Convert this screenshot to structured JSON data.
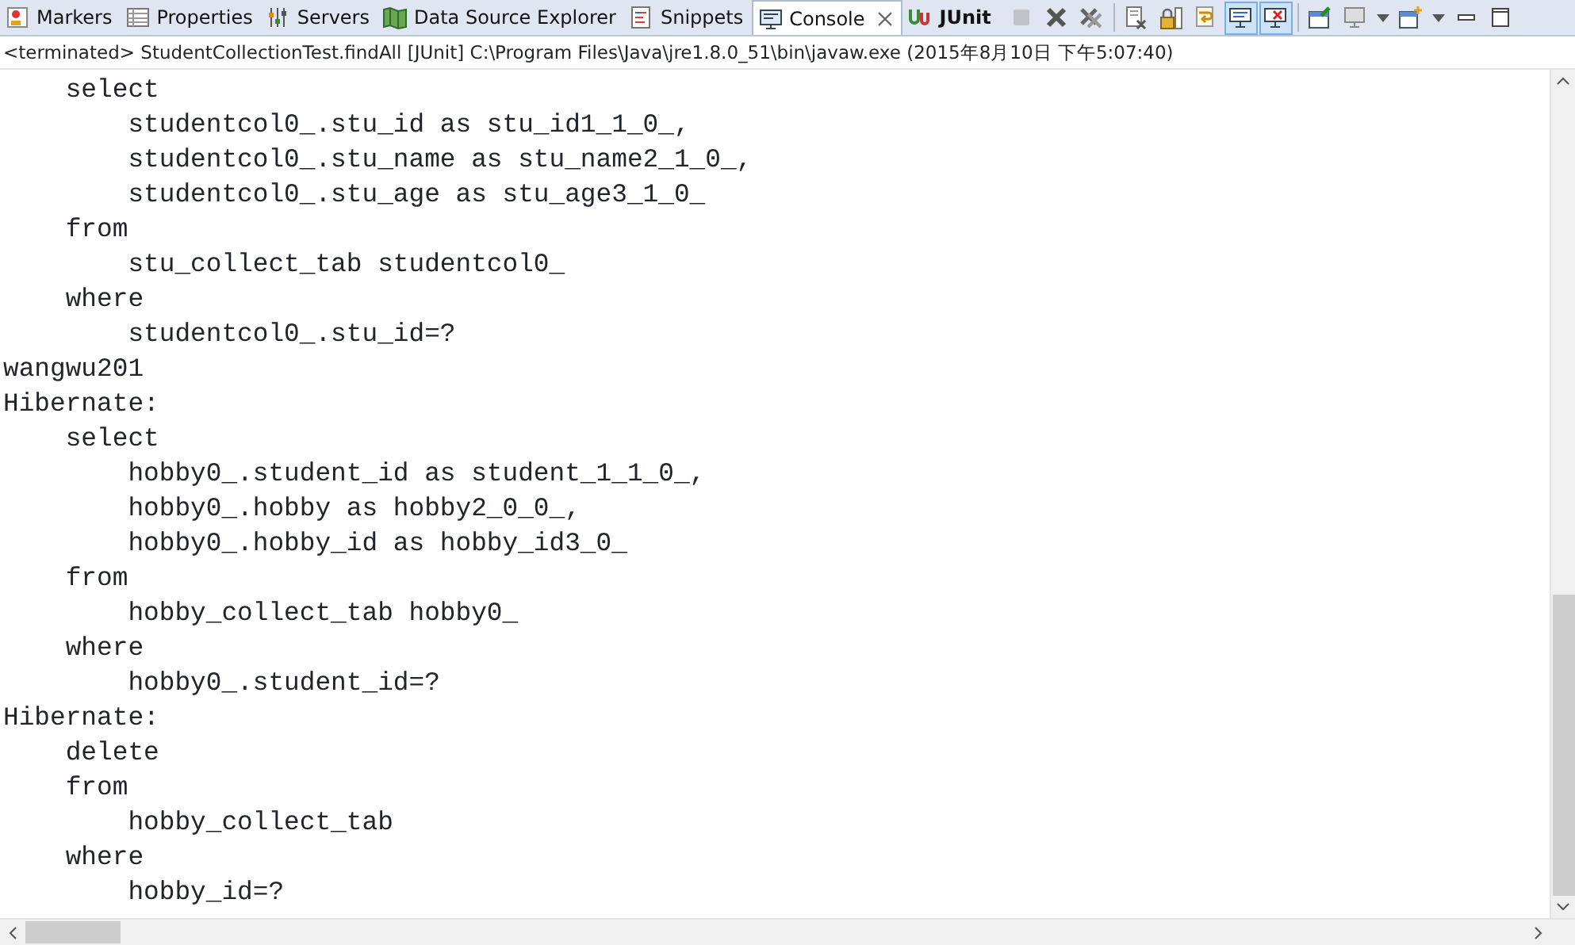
{
  "tabs": [
    {
      "label": "Markers",
      "kind": "markers",
      "selected": false,
      "closable": false
    },
    {
      "label": "Properties",
      "kind": "properties",
      "selected": false,
      "closable": false
    },
    {
      "label": "Servers",
      "kind": "servers",
      "selected": false,
      "closable": false
    },
    {
      "label": "Data Source Explorer",
      "kind": "datasource",
      "selected": false,
      "closable": false
    },
    {
      "label": "Snippets",
      "kind": "snippets",
      "selected": false,
      "closable": false
    },
    {
      "label": "Console",
      "kind": "console",
      "selected": true,
      "closable": true
    },
    {
      "label": "JUnit",
      "kind": "junit",
      "selected": false,
      "closable": false
    }
  ],
  "toolbar": [
    {
      "kind": "stop",
      "disabled": true,
      "on": false
    },
    {
      "kind": "remove",
      "disabled": false,
      "on": false
    },
    {
      "kind": "remove-all",
      "disabled": false,
      "on": false
    },
    {
      "kind": "sep"
    },
    {
      "kind": "clear",
      "disabled": false,
      "on": false
    },
    {
      "kind": "lock",
      "disabled": false,
      "on": false
    },
    {
      "kind": "wrap",
      "disabled": false,
      "on": false
    },
    {
      "kind": "stdout",
      "disabled": false,
      "on": true
    },
    {
      "kind": "stderr",
      "disabled": false,
      "on": true
    },
    {
      "kind": "sep"
    },
    {
      "kind": "pin",
      "disabled": false,
      "on": false
    },
    {
      "kind": "display",
      "disabled": false,
      "on": false
    },
    {
      "kind": "caret",
      "disabled": false,
      "on": false
    },
    {
      "kind": "open",
      "disabled": false,
      "on": false
    },
    {
      "kind": "caret",
      "disabled": false,
      "on": false
    },
    {
      "kind": "minimize",
      "disabled": false,
      "on": false
    },
    {
      "kind": "maximize",
      "disabled": false,
      "on": false
    }
  ],
  "console": {
    "title": "<terminated> StudentCollectionTest.findAll [JUnit] C:\\Program Files\\Java\\jre1.8.0_51\\bin\\javaw.exe (2015年8月10日 下午5:07:40)",
    "lines": [
      "    select",
      "        studentcol0_.stu_id as stu_id1_1_0_,",
      "        studentcol0_.stu_name as stu_name2_1_0_,",
      "        studentcol0_.stu_age as stu_age3_1_0_",
      "    from",
      "        stu_collect_tab studentcol0_",
      "    where",
      "        studentcol0_.stu_id=?",
      "wangwu201",
      "Hibernate:",
      "    select",
      "        hobby0_.student_id as student_1_1_0_,",
      "        hobby0_.hobby as hobby2_0_0_,",
      "        hobby0_.hobby_id as hobby_id3_0_",
      "    from",
      "        hobby_collect_tab hobby0_",
      "    where",
      "        hobby0_.student_id=?",
      "Hibernate:",
      "    delete",
      "    from",
      "        hobby_collect_tab",
      "    where",
      "        hobby_id=?"
    ]
  }
}
